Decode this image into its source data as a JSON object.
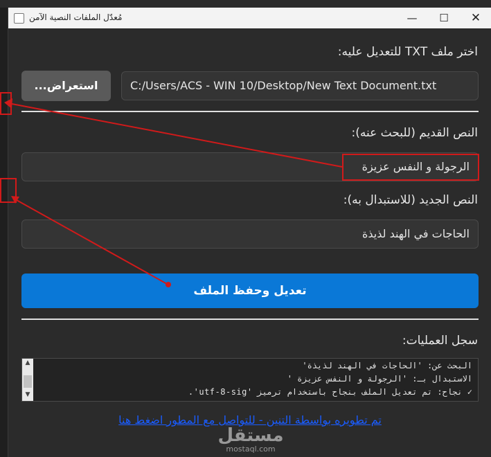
{
  "window": {
    "title": "مُعدّل الملفات النصية الآمن",
    "controls": {
      "minimize": "—",
      "maximize": "☐",
      "close": "✕"
    }
  },
  "file_section": {
    "label": "اختر ملف TXT للتعديل عليه:",
    "path_value": "C:/Users/ACS - WIN 10/Desktop/New Text Document.txt",
    "browse_label": "استعراض..."
  },
  "old_text": {
    "label": "النص القديم (للبحث عنه):",
    "value": "الرجولة و النفس عزيزة"
  },
  "new_text": {
    "label": "النص الجديد (للاستبدال به):",
    "value": "الحاجات في الهند لذيذة"
  },
  "actions": {
    "save_label": "تعديل وحفظ الملف"
  },
  "log": {
    "label": "سجل العمليات:",
    "lines": [
      "البحث عن: 'الحاجات في الهند لذيذة'",
      "الاستبدال بـ: 'الرجولة و النفس عزيزة '",
      "✓ نجاح: تم تعديل الملف بنجاح باستخدام ترميز 'utf-8-sig'."
    ]
  },
  "footer": {
    "link_text": "تم تطويره بواسطة التنين - للتواصل مع المطور اضغط هنا"
  },
  "watermark": {
    "arabic": "مستقل",
    "latin": "mostaql.com"
  },
  "colors": {
    "accent": "#0a78d7",
    "annotation": "#d11a1a",
    "link": "#1a5cff"
  }
}
